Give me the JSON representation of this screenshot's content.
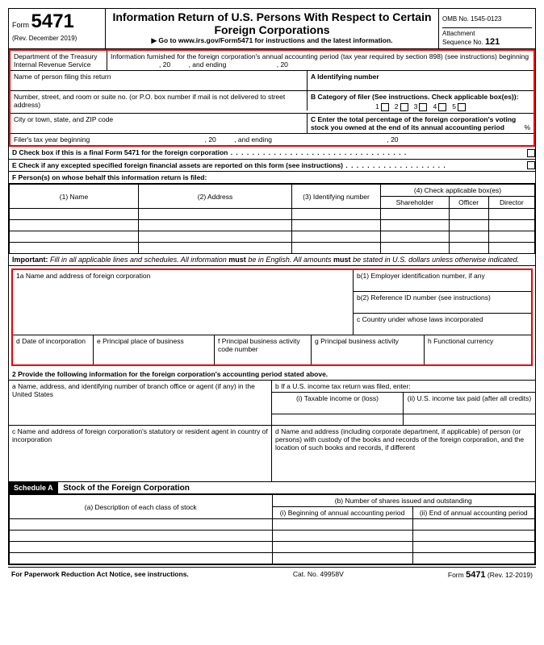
{
  "header": {
    "form_label": "Form",
    "form_number": "5471",
    "revision": "(Rev. December 2019)",
    "dept": "Department of the Treasury",
    "irs": "Internal Revenue Service",
    "title": "Information Return of U.S. Persons With Respect to Certain Foreign Corporations",
    "goto": "▶ Go to www.irs.gov/Form5471 for instructions and the latest information.",
    "omb": "OMB No. 1545-0123",
    "attach": "Attachment",
    "seq_lbl": "Sequence No.",
    "seq_no": "121",
    "info_period": "Information furnished for the foreign corporation's annual accounting period (tax year required by section 898) (see instructions) beginning",
    "comma20": ", 20",
    "and_ending": ", and ending"
  },
  "filer": {
    "name": "Name of person filing this return",
    "ident": "A Identifying number",
    "addr": "Number, street, and room or suite no. (or P.O. box number if mail is not delivered to street address)",
    "cat": "B Category of filer (See instructions. Check applicable box(es)):",
    "c1": "1",
    "c2": "2",
    "c3": "3",
    "c4": "4",
    "c5": "5",
    "city": "City or town, state, and ZIP code",
    "pct": "C Enter the total percentage of the foreign corporation's voting stock you owned at the end of its annual accounting period",
    "pct_sym": "%",
    "ty": "Filer's tax year beginning",
    "d": "D  Check box if this is a final Form 5471 for the foreign corporation",
    "e": "E  Check if any excepted specified foreign financial assets are reported on this form (see instructions)",
    "f": "F  Person(s) on whose behalf this information return is filed:"
  },
  "tableF": {
    "h1": "(1) Name",
    "h2": "(2) Address",
    "h3": "(3) Identifying number",
    "h4": "(4) Check applicable box(es)",
    "h4a": "Shareholder",
    "h4b": "Officer",
    "h4c": "Director"
  },
  "important": {
    "lead": "Important:",
    "text": " Fill in all applicable lines and schedules. All information ",
    "must": "must",
    "text2": " be in English. All amounts ",
    "text3": " be stated in U.S. dollars unless otherwise indicated."
  },
  "sec1": {
    "a": "1a Name and address of foreign corporation",
    "b1": "b(1) Employer identification number, if any",
    "b2": "b(2) Reference ID number (see instructions)",
    "c": "c   Country under whose laws incorporated",
    "d": "d Date of incorporation",
    "e": "e Principal place of business",
    "f": "f Principal business activity code number",
    "g": "g Principal business activity",
    "h": "h Functional currency"
  },
  "sec2": {
    "lead": "2   Provide the following information for the foreign corporation's accounting period stated above.",
    "a": "a Name, address, and identifying number of branch office or agent (if any) in the United States",
    "b": "b If a U.S. income tax return was filed, enter:",
    "bi": "(i)  Taxable income or (loss)",
    "bii": "(ii)  U.S. income tax paid (after all credits)",
    "c": "c Name and address of foreign corporation's statutory or resident agent in country of incorporation",
    "d": "d Name and address (including corporate department, if applicable) of person (or persons) with custody of the books and records of the foreign corporation, and the location of such books and records, if different"
  },
  "schedA": {
    "label": "Schedule A",
    "title": "Stock of the Foreign Corporation",
    "ha": "(a) Description of each class of stock",
    "hb": "(b) Number of shares issued and outstanding",
    "hbi": "(i)  Beginning of annual accounting period",
    "hbii": "(ii)  End of annual accounting period"
  },
  "footer": {
    "left": "For Paperwork Reduction Act Notice, see instructions.",
    "mid": "Cat. No. 49958V",
    "r1": "Form ",
    "r2": "5471",
    "r3": " (Rev. 12-2019)"
  }
}
